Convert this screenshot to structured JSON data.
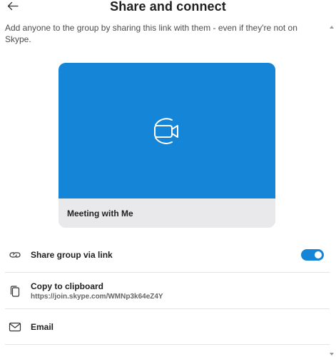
{
  "header": {
    "title": "Share and connect",
    "back_icon": "arrow-left-icon"
  },
  "description": "Add anyone to the group by sharing this link with them - even if they're not on Skype.",
  "card": {
    "label": "Meeting with Me",
    "preview_color": "#1585d8",
    "icon": "video-camera-icon"
  },
  "options": {
    "share_link": {
      "label": "Share group via link",
      "icon": "link-icon",
      "toggle_on": true
    },
    "copy": {
      "label": "Copy to clipboard",
      "url": "https://join.skype.com/WMNp3k64eZ4Y",
      "icon": "copy-icon"
    },
    "email": {
      "label": "Email",
      "icon": "mail-icon"
    }
  },
  "colors": {
    "accent": "#1585d8",
    "card_footer": "#e9e9ec"
  }
}
